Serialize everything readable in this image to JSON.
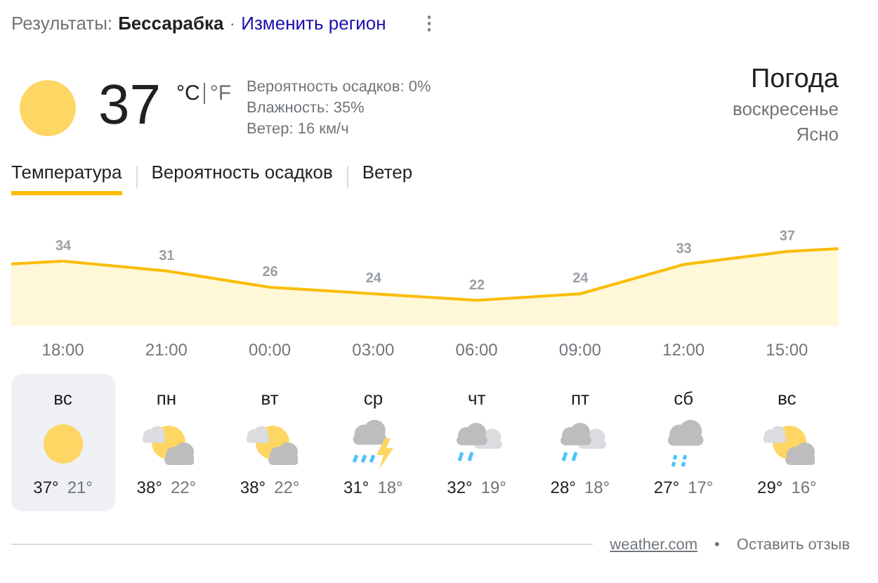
{
  "header": {
    "label": "Результаты:",
    "region": "Бессарабка",
    "separator": "·",
    "link": "Изменить регион",
    "menu": "⋮"
  },
  "current": {
    "temperature": "37",
    "units": [
      {
        "label": "°C",
        "selected": true
      },
      {
        "label": "°F",
        "selected": false
      }
    ],
    "details": [
      "Вероятность осадков: 0%",
      "Влажность: 35%",
      "Ветер: 16 км/ч"
    ],
    "title": "Погода",
    "day": "воскресенье",
    "condition": "Ясно"
  },
  "tabs": [
    {
      "label": "Температура",
      "selected": true
    },
    {
      "label": "Вероятность осадков",
      "selected": false
    },
    {
      "label": "Ветер",
      "selected": false
    }
  ],
  "chart_data": {
    "type": "area",
    "categories": [
      "18:00",
      "21:00",
      "00:00",
      "03:00",
      "06:00",
      "09:00",
      "12:00",
      "15:00"
    ],
    "data_labels": true,
    "series": [
      {
        "color": "#fbbc04",
        "values": [
          34,
          31,
          26,
          24,
          22,
          24,
          33,
          37
        ]
      }
    ]
  },
  "days": [
    {
      "name": "вс",
      "kind": "sun",
      "high": "37°",
      "low": "21°",
      "selected": true
    },
    {
      "name": "пн",
      "kind": "partly",
      "high": "38°",
      "low": "22°",
      "selected": false
    },
    {
      "name": "вт",
      "kind": "partly",
      "high": "38°",
      "low": "22°",
      "selected": false
    },
    {
      "name": "ср",
      "kind": "storm",
      "high": "31°",
      "low": "18°",
      "selected": false
    },
    {
      "name": "чт",
      "kind": "rain",
      "high": "32°",
      "low": "19°",
      "selected": false
    },
    {
      "name": "пт",
      "kind": "rain",
      "high": "28°",
      "low": "18°",
      "selected": false
    },
    {
      "name": "сб",
      "kind": "showers",
      "high": "27°",
      "low": "17°",
      "selected": false
    },
    {
      "name": "вс",
      "kind": "partly",
      "high": "29°",
      "low": "16°",
      "selected": false
    }
  ],
  "footer": {
    "source": "weather.com",
    "separator": "•",
    "feedback": "Оставить отзыв"
  }
}
